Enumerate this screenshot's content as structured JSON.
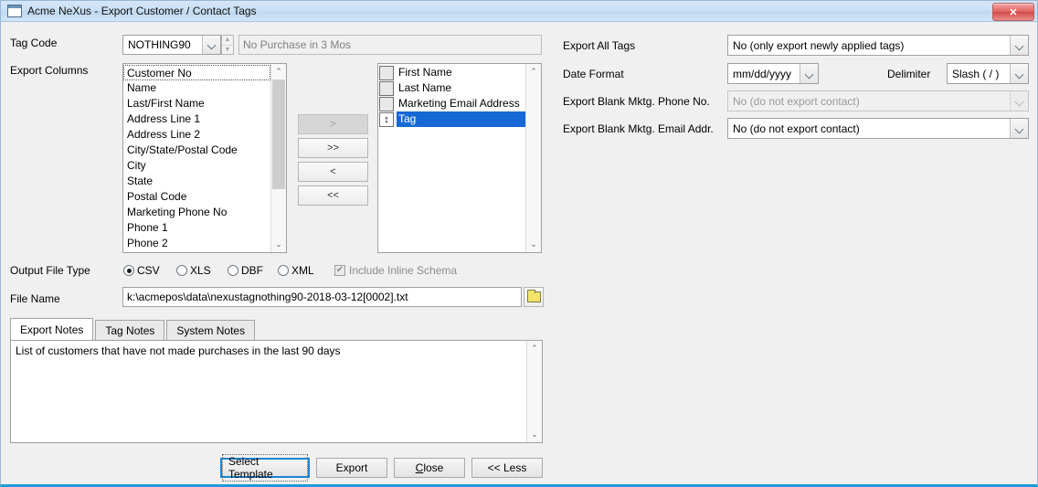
{
  "window": {
    "title": "Acme NeXus - Export Customer / Contact Tags",
    "icon": "window-icon",
    "close_label": "✕"
  },
  "form": {
    "tag_code_label": "Tag Code",
    "tag_code_value": "NOTHING90",
    "tag_desc_value": "No Purchase in 3 Mos",
    "export_columns_label": "Export Columns"
  },
  "available_columns": [
    "Customer No",
    "Name",
    "Last/First Name",
    "Address Line 1",
    "Address Line 2",
    "City/State/Postal Code",
    "City",
    "State",
    "Postal Code",
    "Marketing Phone No",
    "Phone 1",
    "Phone 2"
  ],
  "selected_columns": [
    {
      "label": "First Name",
      "selected": false
    },
    {
      "label": "Last Name",
      "selected": false
    },
    {
      "label": "Marketing Email Address",
      "selected": false
    },
    {
      "label": "Tag",
      "selected": true
    }
  ],
  "transfer_buttons": [
    {
      "label": ">",
      "name": "move-right-button",
      "disabled": true
    },
    {
      "label": ">>",
      "name": "move-all-right-button",
      "disabled": false
    },
    {
      "label": "<",
      "name": "move-left-button",
      "disabled": false
    },
    {
      "label": "<<",
      "name": "move-all-left-button",
      "disabled": false
    }
  ],
  "options": {
    "export_all_tags_label": "Export All Tags",
    "export_all_tags_value": "No (only export newly applied tags)",
    "date_format_label": "Date Format",
    "date_format_value": "mm/dd/yyyy",
    "delimiter_label": "Delimiter",
    "delimiter_value": "Slash ( / )",
    "blank_phone_label": "Export Blank Mktg. Phone No.",
    "blank_phone_value": "No (do not export contact)",
    "blank_email_label": "Export Blank Mktg. Email Addr.",
    "blank_email_value": "No (do not export contact)"
  },
  "output": {
    "file_type_label": "Output File Type",
    "types": [
      {
        "label": "CSV",
        "checked": true
      },
      {
        "label": "XLS",
        "checked": false
      },
      {
        "label": "DBF",
        "checked": false
      },
      {
        "label": "XML",
        "checked": false
      }
    ],
    "inline_schema_label": "Include Inline Schema",
    "inline_schema_mark": "✔",
    "file_name_label": "File Name",
    "file_name_value": "k:\\acmepos\\data\\nexustagnothing90-2018-03-12[0002].txt",
    "browse_icon": "folder-icon"
  },
  "tabs": [
    {
      "label": "Export Notes",
      "active": true
    },
    {
      "label": "Tag Notes",
      "active": false
    },
    {
      "label": "System Notes",
      "active": false
    }
  ],
  "notes_text": "List of customers that have not made purchases in the last 90 days",
  "buttons": [
    {
      "label": "Select Template",
      "name": "select-template-button",
      "default": true
    },
    {
      "label": "Export",
      "name": "export-button",
      "default": false
    },
    {
      "label": "Close",
      "name": "close-button",
      "default": false,
      "accel": "C"
    },
    {
      "label": "<< Less",
      "name": "less-button",
      "default": false
    }
  ],
  "glyphs": {
    "up": "⌃",
    "down": "⌄",
    "updown": "↕",
    "spin_up": "▲",
    "spin_down": "▼"
  }
}
